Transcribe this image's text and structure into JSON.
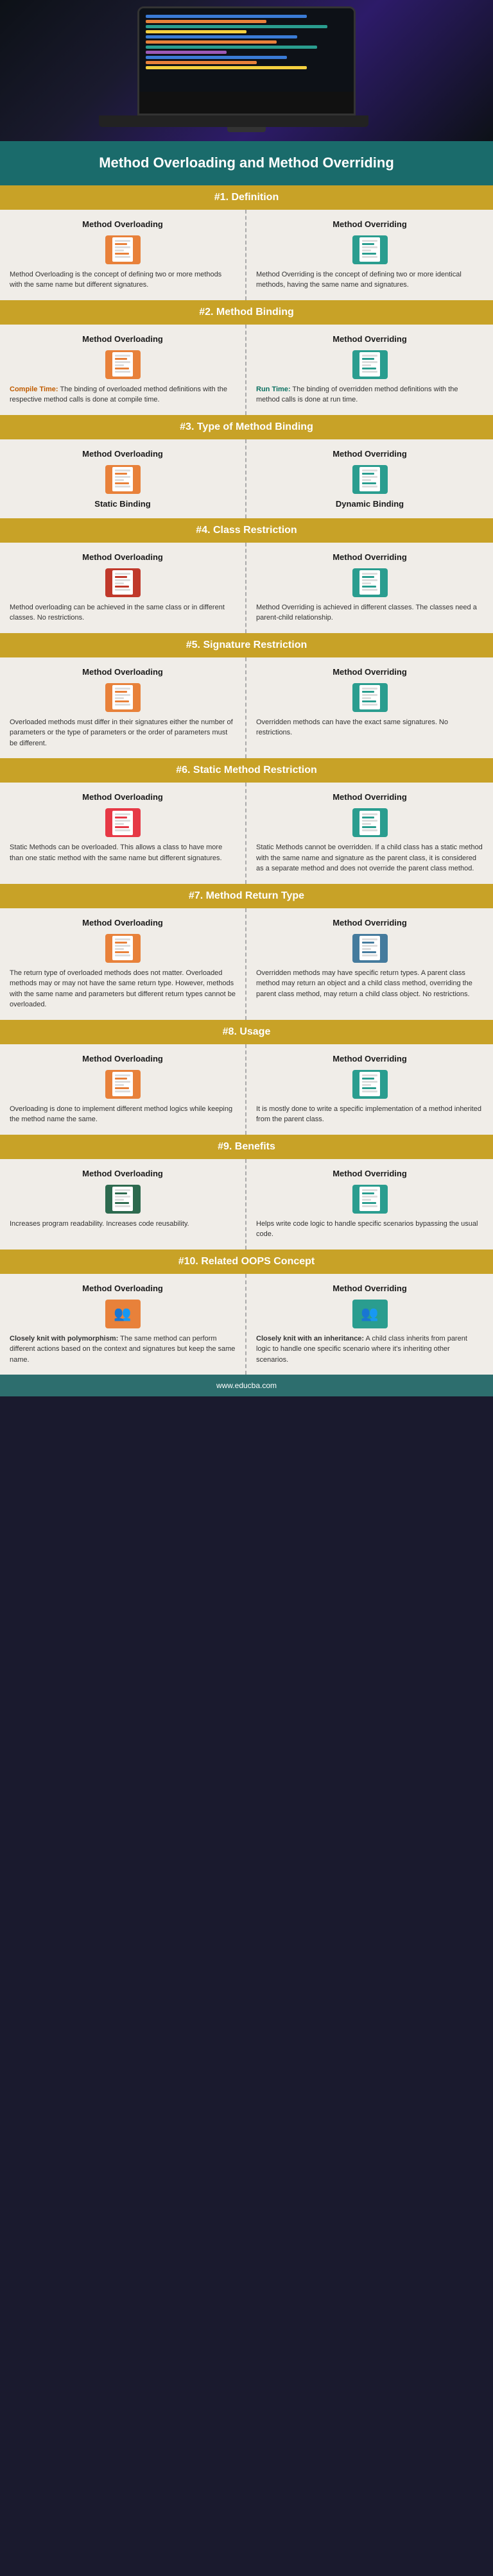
{
  "hero": {
    "alt": "Laptop with code on screen"
  },
  "main_title": "Method Overloading and Method Overriding",
  "sections": [
    {
      "id": "s1",
      "header": "#1. Definition",
      "left_title": "Method Overloading",
      "right_title": "Method Overriding",
      "left_body": "Method Overloading is the concept of defining two or more methods with the same name but different signatures.",
      "right_body": "Method Overriding is the concept of defining two or more identical methods, having the same name and signatures."
    },
    {
      "id": "s2",
      "header": "#2. Method Binding",
      "left_title": "Method Overloading",
      "right_title": "Method Overriding",
      "left_body": "<strong class='highlight-orange'>Compile Time:</strong> The binding of overloaded method definitions with the respective method calls is done at compile time.",
      "right_body": "<strong class='highlight-teal'>Run Time:</strong> The binding of overridden method definitions with the method calls is done at run time."
    },
    {
      "id": "s3",
      "header": "#3. Type of Method Binding",
      "left_title": "Method Overloading",
      "right_title": "Method Overriding",
      "left_label": "Static Binding",
      "right_label": "Dynamic Binding"
    },
    {
      "id": "s4",
      "header": "#4. Class Restriction",
      "left_title": "Method Overloading",
      "right_title": "Method Overriding",
      "left_body": "Method overloading can be achieved in the same class or in different classes. No restrictions.",
      "right_body": "Method Overriding is achieved in different classes. The classes need a parent-child relationship."
    },
    {
      "id": "s5",
      "header": "#5. Signature Restriction",
      "left_title": "Method Overloading",
      "right_title": "Method Overriding",
      "left_body": "Overloaded methods must differ in their signatures either the number of parameters or the type of parameters or the order of parameters must be different.",
      "right_body": "Overridden methods can have the exact same signatures. No restrictions."
    },
    {
      "id": "s6",
      "header": "#6. Static Method Restriction",
      "left_title": "Method Overloading",
      "right_title": "Method Overriding",
      "left_body": "Static Methods can be overloaded. This allows a class to have more than one static method with the same name but different signatures.",
      "right_body": "Static Methods cannot be overridden. If a child class has a static method with the same name and signature as the parent class, it is considered as a separate method and does not override the parent class method."
    },
    {
      "id": "s7",
      "header": "#7. Method Return Type",
      "left_title": "Method Overloading",
      "right_title": "Method Overriding",
      "left_body": "The return type of overloaded methods does not matter. Overloaded methods may or may not have the same return type. However, methods with the same name and parameters but different return types cannot be overloaded.",
      "right_body": "Overridden methods may have specific return types. A parent class method may return an object and a child class method, overriding the parent class method, may return a child class object. No restrictions."
    },
    {
      "id": "s8",
      "header": "#8. Usage",
      "left_title": "Method Overloading",
      "right_title": "Method Overriding",
      "left_body": "Overloading is done to implement different method logics while keeping the method name the same.",
      "right_body": "It is mostly done to write a specific implementation of a method inherited from the parent class."
    },
    {
      "id": "s9",
      "header": "#9. Benefits",
      "left_title": "Method Overloading",
      "right_title": "Method Overriding",
      "left_body": "Increases program readability. Increases code reusability.",
      "right_body": "Helps write code logic to handle specific scenarios bypassing the usual code."
    },
    {
      "id": "s10",
      "header": "#10. Related OOPS Concept",
      "left_title": "Method Overloading",
      "right_title": "Method Overriding",
      "left_body": "<strong>Closely knit with polymorphism:</strong> The same method can perform different actions based on the context and signatures but keep the same name.",
      "right_body": "<strong>Closely knit with an inheritance:</strong> A child class inherits from parent logic to handle one specific scenario where it's inheriting other scenarios."
    }
  ],
  "footer": "www.educba.com"
}
